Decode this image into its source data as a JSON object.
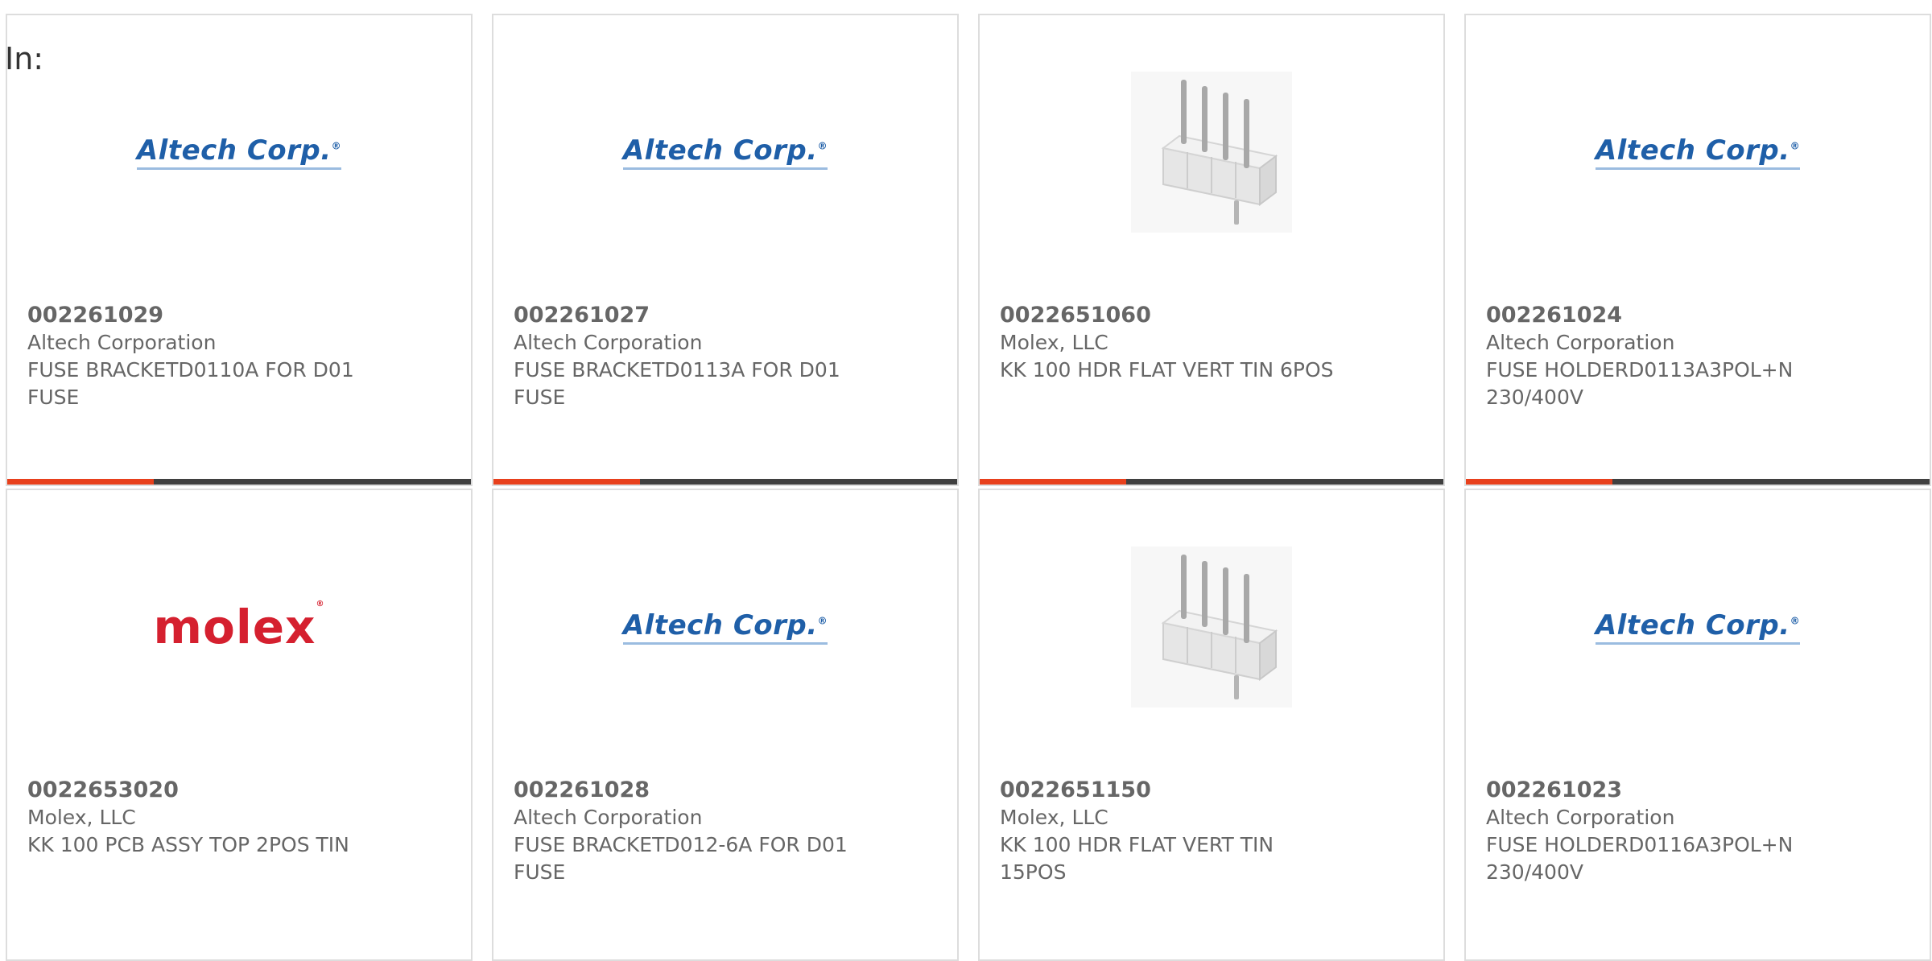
{
  "filter_label": "In:",
  "colors": {
    "accent": "#e8401c",
    "bar": "#404040",
    "altech_blue": "#1f5fa8",
    "molex_red": "#d5202f"
  },
  "products": [
    {
      "part_number": "002261029",
      "manufacturer": "Altech Corporation",
      "description": "FUSE BRACKETD0110A FOR D01 FUSE",
      "image": "altech-logo",
      "logo_text": "Altech Corp."
    },
    {
      "part_number": "002261027",
      "manufacturer": "Altech Corporation",
      "description": "FUSE BRACKETD0113A FOR D01 FUSE",
      "image": "altech-logo",
      "logo_text": "Altech Corp."
    },
    {
      "part_number": "0022651060",
      "manufacturer": "Molex, LLC",
      "description": "KK 100 HDR FLAT VERT TIN 6POS",
      "image": "header-connector-photo"
    },
    {
      "part_number": "002261024",
      "manufacturer": "Altech Corporation",
      "description": "FUSE HOLDERD0113A3POL+N 230/400V",
      "image": "altech-logo",
      "logo_text": "Altech Corp."
    },
    {
      "part_number": "0022653020",
      "manufacturer": "Molex, LLC",
      "description": "KK 100 PCB ASSY TOP 2POS TIN",
      "image": "molex-logo",
      "logo_text": "molex"
    },
    {
      "part_number": "002261028",
      "manufacturer": "Altech Corporation",
      "description": "FUSE BRACKETD012-6A FOR D01 FUSE",
      "image": "altech-logo",
      "logo_text": "Altech Corp."
    },
    {
      "part_number": "0022651150",
      "manufacturer": "Molex, LLC",
      "description": "KK 100 HDR FLAT VERT TIN 15POS",
      "image": "header-connector-photo"
    },
    {
      "part_number": "002261023",
      "manufacturer": "Altech Corporation",
      "description": "FUSE HOLDERD0116A3POL+N 230/400V",
      "image": "altech-logo",
      "logo_text": "Altech Corp."
    }
  ]
}
